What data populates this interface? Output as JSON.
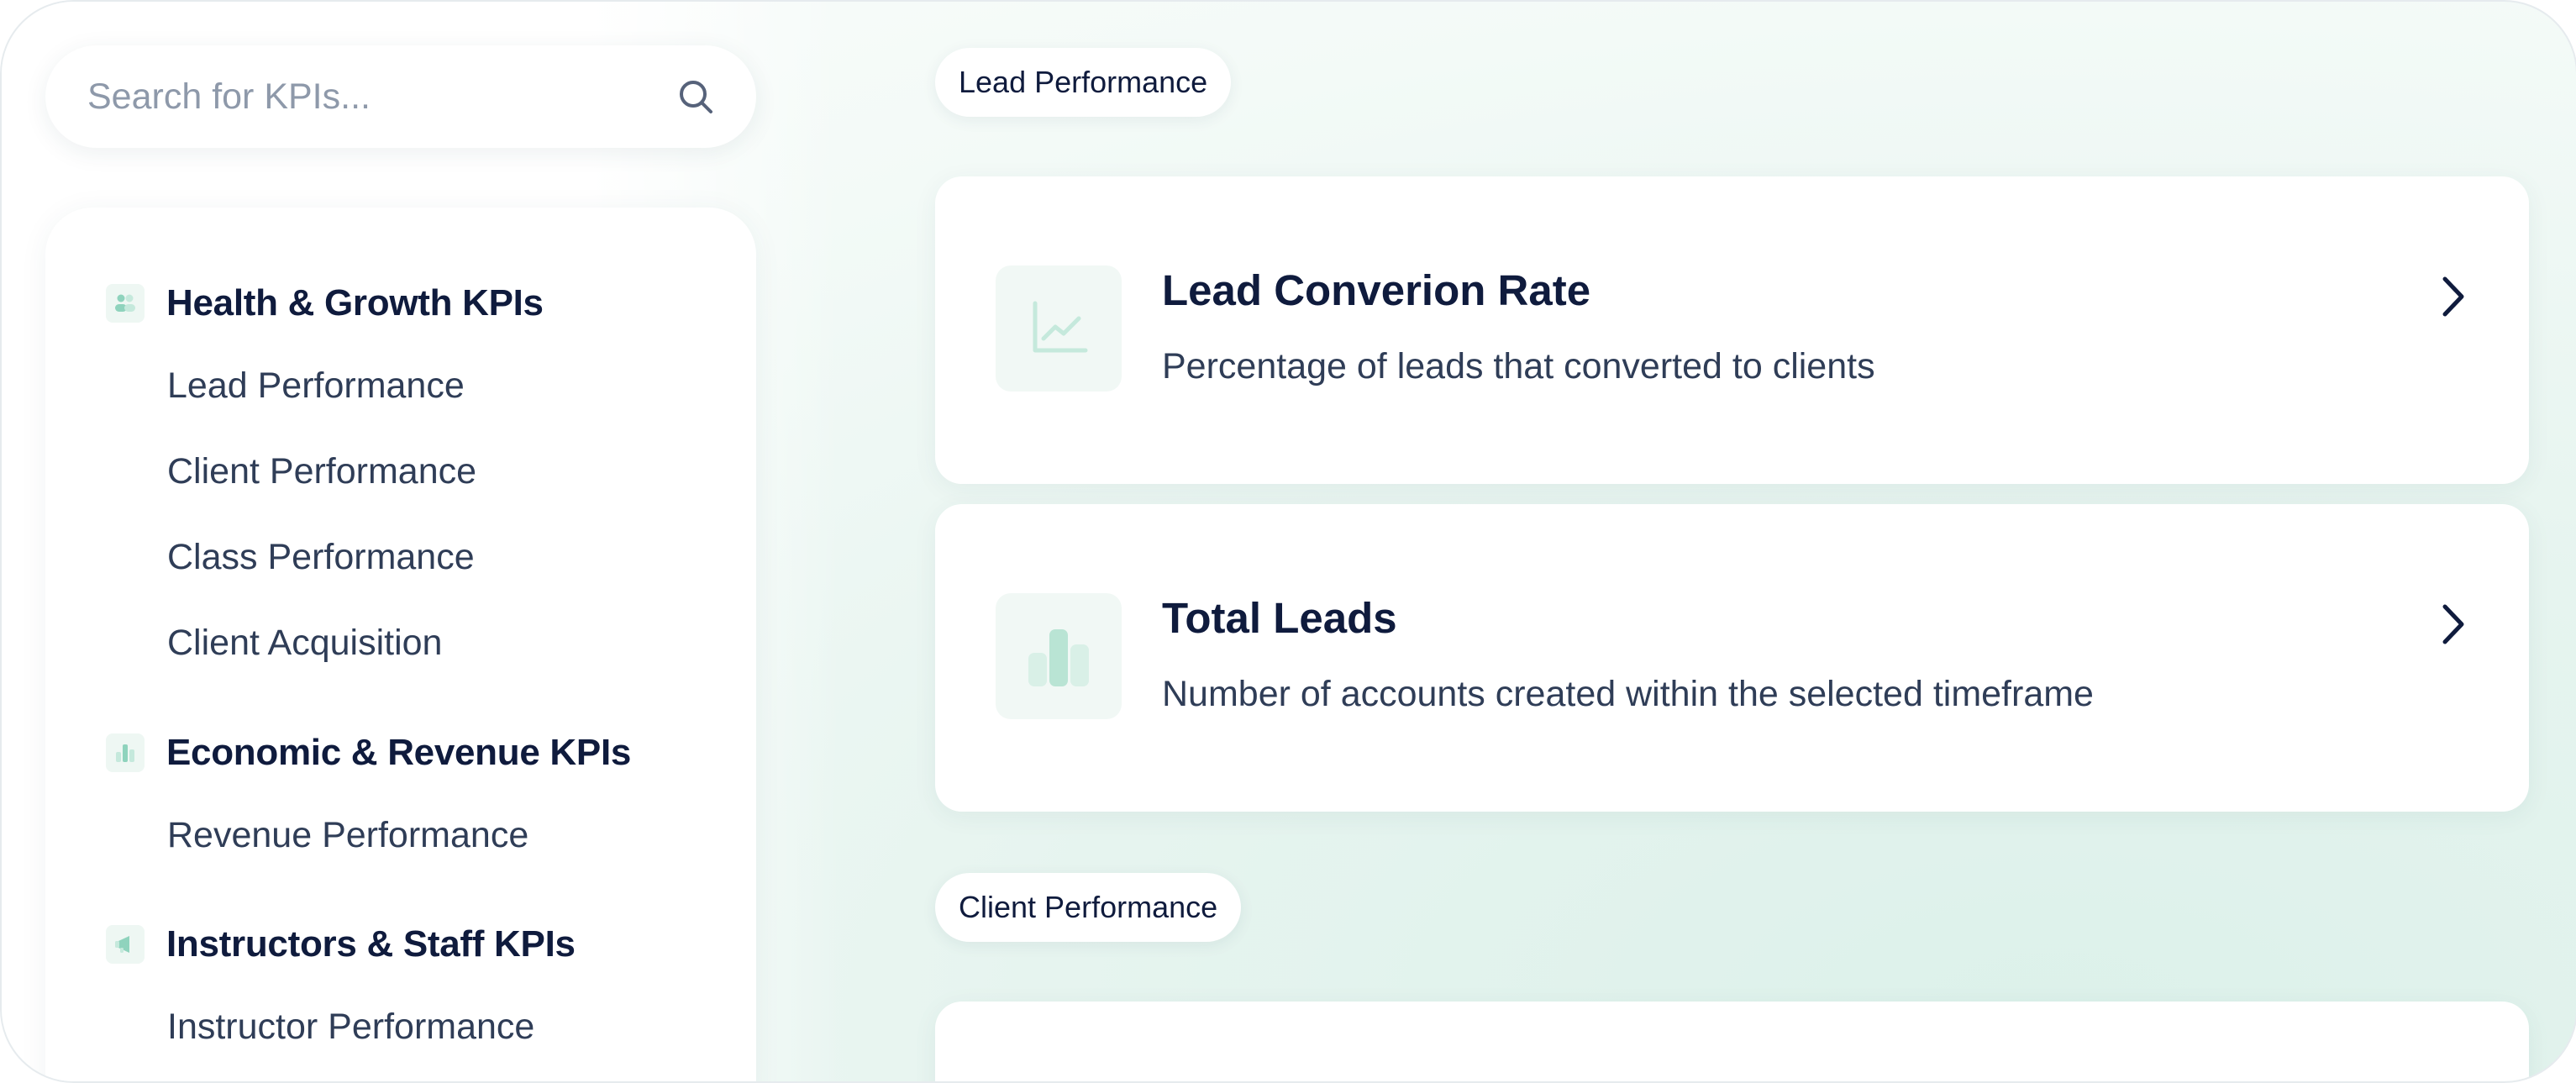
{
  "search": {
    "placeholder": "Search for KPIs..."
  },
  "sidebar": {
    "groups": [
      {
        "icon": "people-icon",
        "title": "Health & Growth KPIs",
        "items": [
          "Lead Performance",
          "Client Performance",
          "Class Performance",
          "Client Acquisition"
        ]
      },
      {
        "icon": "bar-chart-icon",
        "title": "Economic & Revenue KPIs",
        "items": [
          "Revenue Performance"
        ]
      },
      {
        "icon": "megaphone-icon",
        "title": "Instructors & Staff KPIs",
        "items": [
          "Instructor Performance"
        ]
      }
    ]
  },
  "main": {
    "sections": [
      {
        "label": "Lead Performance",
        "cards": [
          {
            "icon": "line-chart-icon",
            "title": "Lead Converion Rate",
            "description": "Percentage of leads that converted to clients"
          },
          {
            "icon": "bar-chart-icon",
            "title": "Total Leads",
            "description": "Number of accounts created within the selected timeframe"
          }
        ]
      },
      {
        "label": "Client Performance",
        "cards": []
      }
    ]
  },
  "colors": {
    "accent": "#8fd3bd",
    "text": "#0f1b3d",
    "muted": "#2f3d57",
    "background_tint": "#e2f3ed"
  }
}
